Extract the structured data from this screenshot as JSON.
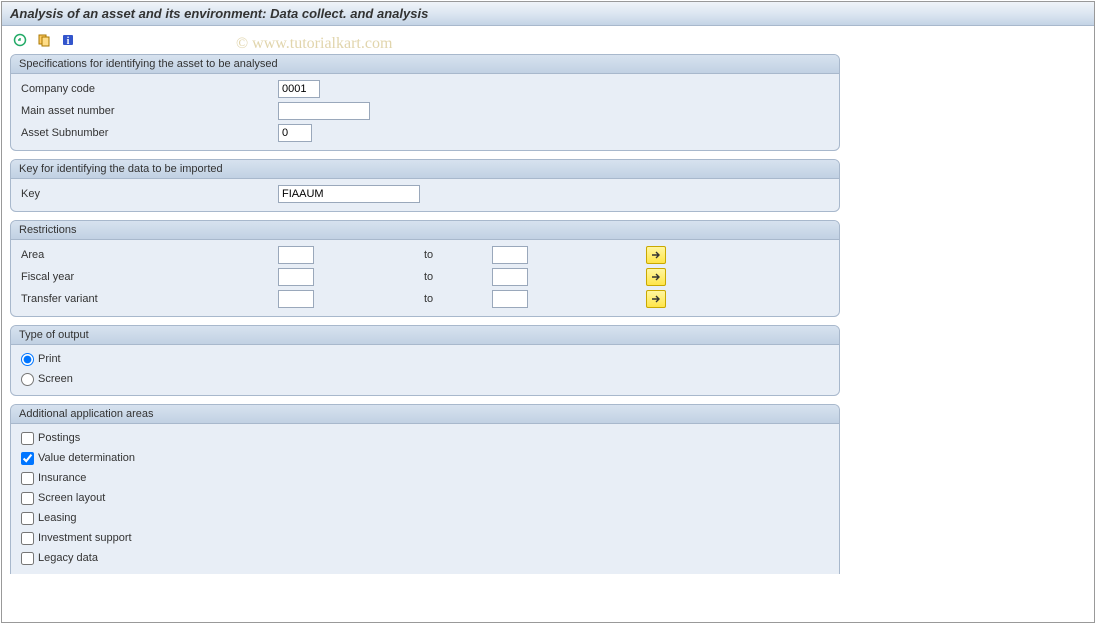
{
  "title": "Analysis of an asset and its environment: Data collect. and analysis",
  "watermark": "© www.tutorialkart.com",
  "toolbar": {
    "execute": "Execute",
    "variant": "Get Variant",
    "info": "Information"
  },
  "groups": {
    "spec": {
      "title": "Specifications for identifying the asset to be analysed",
      "company_code_label": "Company code",
      "company_code_value": "0001",
      "main_asset_label": "Main asset number",
      "main_asset_value": "",
      "subnumber_label": "Asset Subnumber",
      "subnumber_value": "0"
    },
    "key": {
      "title": "Key for identifying the data to be imported",
      "key_label": "Key",
      "key_value": "FIAAUM"
    },
    "restrictions": {
      "title": "Restrictions",
      "area_label": "Area",
      "fiscal_label": "Fiscal year",
      "transfer_label": "Transfer variant",
      "to_label": "to",
      "area_from": "",
      "area_to": "",
      "fiscal_from": "",
      "fiscal_to": "",
      "transfer_from": "",
      "transfer_to": ""
    },
    "output": {
      "title": "Type of output",
      "print_label": "Print",
      "screen_label": "Screen",
      "selected": "print"
    },
    "areas": {
      "title": "Additional application areas",
      "postings": "Postings",
      "value_det": "Value determination",
      "insurance": "Insurance",
      "screen_layout": "Screen layout",
      "leasing": "Leasing",
      "investment": "Investment support",
      "legacy": "Legacy data"
    }
  }
}
